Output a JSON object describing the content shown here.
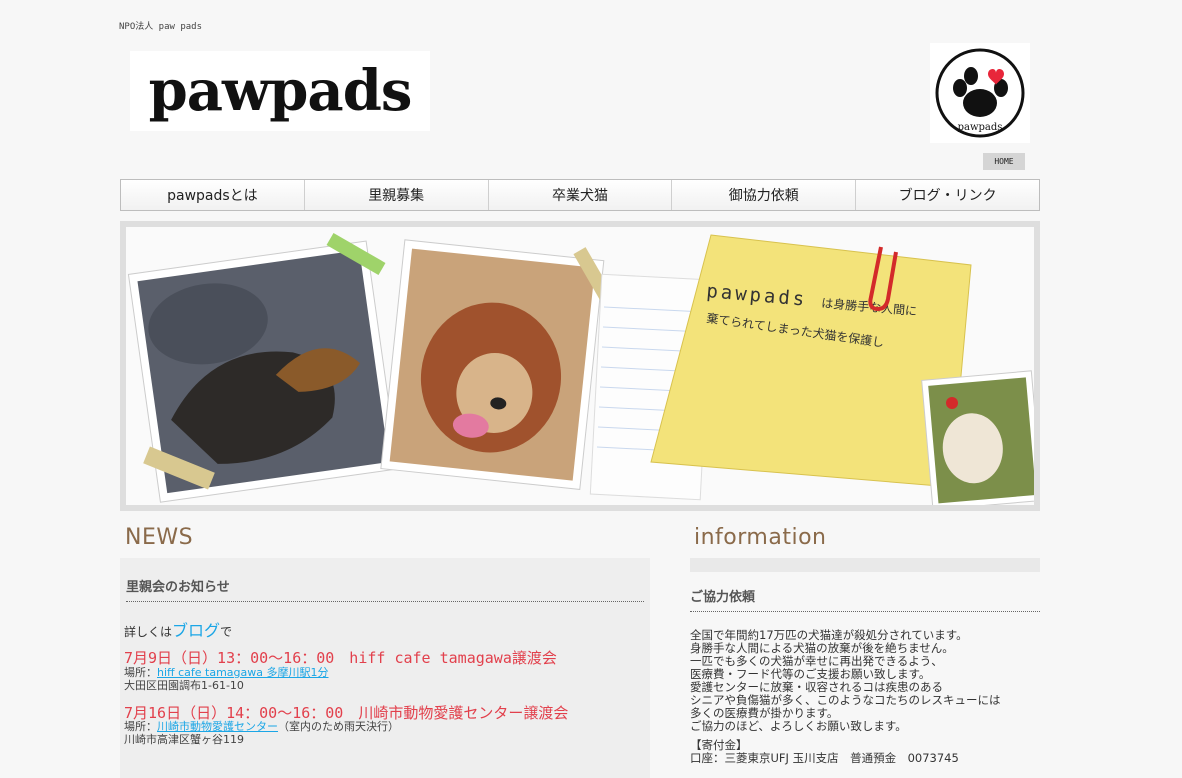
{
  "header": {
    "org_tag": "NPO法人 paw pads",
    "logo_text": "pawpads",
    "badge_text": "pawpads",
    "home_label": "HOME"
  },
  "nav": {
    "items": [
      {
        "label": "pawpadsとは"
      },
      {
        "label": "里親募集"
      },
      {
        "label": "卒業犬猫"
      },
      {
        "label": "御協力依頼"
      },
      {
        "label": "ブログ・リンク"
      }
    ]
  },
  "hero": {
    "note_title": "pawpads",
    "note_line1": "は身勝手な人間に",
    "note_line2": "棄てられてしまった犬猫を保護し"
  },
  "news": {
    "heading": "NEWS",
    "subheading": "里親会のお知らせ",
    "lead_prefix": "詳しくは",
    "lead_link": "ブログ",
    "lead_suffix": "で",
    "events": [
      {
        "title": "7月9日（日）13：00～16：00　hiff cafe tamagawa譲渡会",
        "place_label": "場所：",
        "place_link": "hiff cafe tamagawa 多摩川駅1分",
        "place_note": "",
        "address": "大田区田園調布1-61-10"
      },
      {
        "title": "7月16日（日）14：00～16：00　川崎市動物愛護センター譲渡会",
        "place_label": "場所：",
        "place_link": "川崎市動物愛護センター",
        "place_note": "（室内のため雨天決行）",
        "address": "川崎市高津区蟹ヶ谷119"
      }
    ]
  },
  "information": {
    "heading": "information",
    "subheading": "ご協力依頼",
    "paragraph": [
      "全国で年間約17万匹の犬猫達が殺処分されています。",
      "身勝手な人間による犬猫の放棄が後を絶ちません。",
      "一匹でも多くの犬猫が幸せに再出発できるよう、",
      "医療費・フード代等のご支援お願い致します。",
      "愛護センターに放棄・収容されるコは疾患のある",
      "シニアや負傷猫が多く、このようなコたちのレスキューには",
      "多くの医療費が掛かります。",
      "ご協力のほど、よろしくお願い致します。",
      ""
    ],
    "donation_heading": "【寄付金】",
    "account_line": "口座：三菱東京UFJ 玉川支店　普通預金　0073745"
  },
  "colors": {
    "accent_red": "#e2404c",
    "link_blue": "#1ba6e6",
    "heading_brown": "#8a6a4a",
    "heart_red": "#e8263a"
  }
}
